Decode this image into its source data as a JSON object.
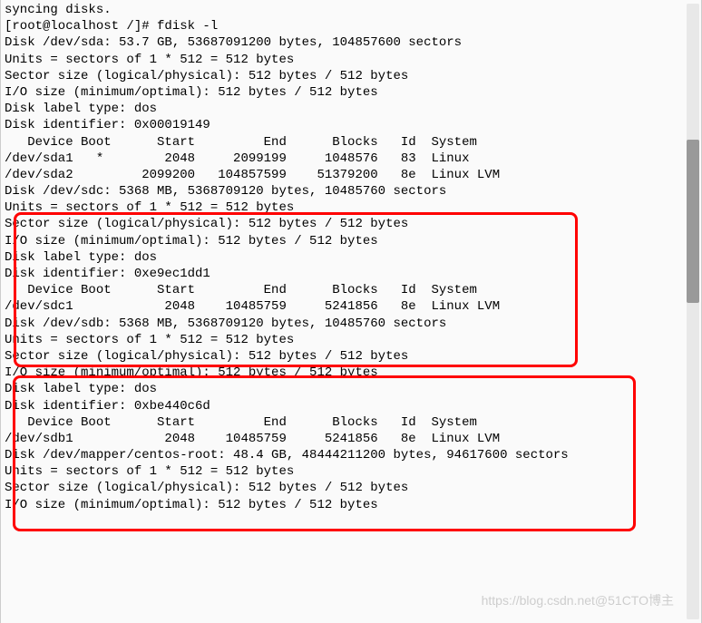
{
  "terminal": {
    "lines": [
      "syncing disks.",
      "[root@localhost /]# fdisk -l",
      "",
      "Disk /dev/sda: 53.7 GB, 53687091200 bytes, 104857600 sectors",
      "Units = sectors of 1 * 512 = 512 bytes",
      "Sector size (logical/physical): 512 bytes / 512 bytes",
      "I/O size (minimum/optimal): 512 bytes / 512 bytes",
      "Disk label type: dos",
      "Disk identifier: 0x00019149",
      "",
      "   Device Boot      Start         End      Blocks   Id  System",
      "/dev/sda1   *        2048     2099199     1048576   83  Linux",
      "/dev/sda2         2099200   104857599    51379200   8e  Linux LVM",
      "",
      "Disk /dev/sdc: 5368 MB, 5368709120 bytes, 10485760 sectors",
      "Units = sectors of 1 * 512 = 512 bytes",
      "Sector size (logical/physical): 512 bytes / 512 bytes",
      "I/O size (minimum/optimal): 512 bytes / 512 bytes",
      "Disk label type: dos",
      "Disk identifier: 0xe9ec1dd1",
      "",
      "   Device Boot      Start         End      Blocks   Id  System",
      "/dev/sdc1            2048    10485759     5241856   8e  Linux LVM",
      "",
      "Disk /dev/sdb: 5368 MB, 5368709120 bytes, 10485760 sectors",
      "Units = sectors of 1 * 512 = 512 bytes",
      "Sector size (logical/physical): 512 bytes / 512 bytes",
      "I/O size (minimum/optimal): 512 bytes / 512 bytes",
      "Disk label type: dos",
      "Disk identifier: 0xbe440c6d",
      "",
      "   Device Boot      Start         End      Blocks   Id  System",
      "/dev/sdb1            2048    10485759     5241856   8e  Linux LVM",
      "",
      "Disk /dev/mapper/centos-root: 48.4 GB, 48444211200 bytes, 94617600 sectors",
      "Units = sectors of 1 * 512 = 512 bytes",
      "Sector size (logical/physical): 512 bytes / 512 bytes",
      "I/O size (minimum/optimal): 512 bytes / 512 bytes"
    ]
  },
  "watermark": {
    "text": "https://blog.csdn.net@51CTO博主"
  }
}
